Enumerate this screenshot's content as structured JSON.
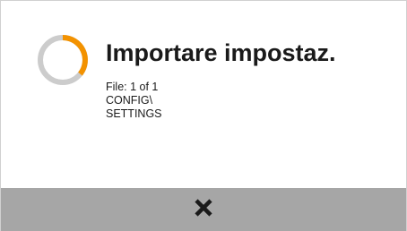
{
  "dialog": {
    "title": "Importare impostaz.",
    "details": {
      "file_progress": "File: 1 of 1",
      "path_line1": "CONFIG\\",
      "path_line2": "SETTINGS"
    }
  },
  "spinner": {
    "icon": "loading-spinner-icon",
    "track_color": "#cccccc",
    "progress_color": "#f39200"
  },
  "footer": {
    "background_color": "#a6a6a6",
    "cancel_icon": "close-icon"
  }
}
